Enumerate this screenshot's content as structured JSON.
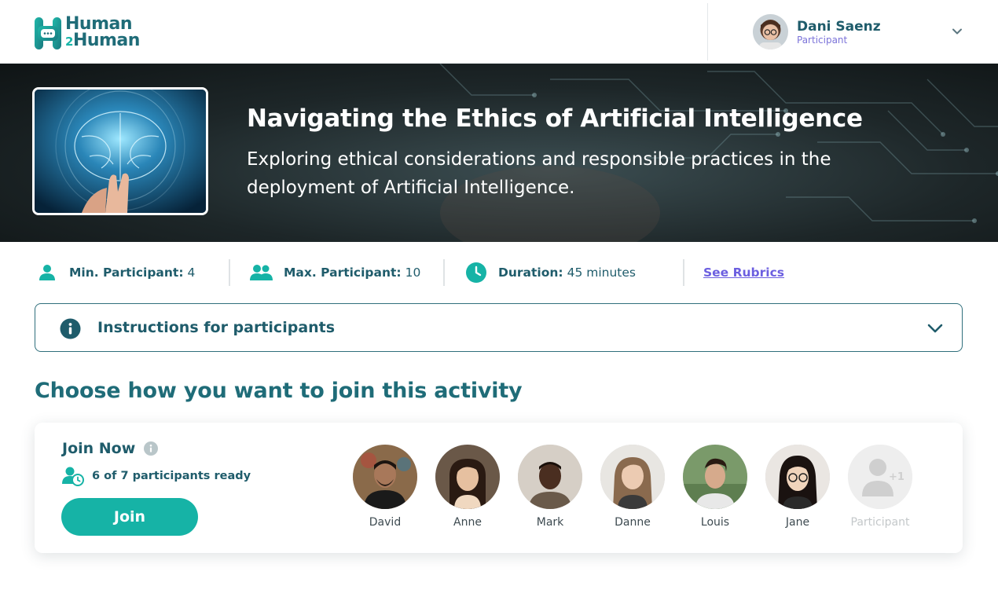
{
  "header": {
    "logo": {
      "line1": "Human",
      "num": "2",
      "line2": "Human"
    },
    "user": {
      "name": "Dani Saenz",
      "role": "Participant"
    }
  },
  "hero": {
    "title": "Navigating the Ethics of Artificial Intelligence",
    "subtitle": "Exploring ethical considerations and responsible practices in the deployment of Artificial Intelligence."
  },
  "stats": {
    "min_label": "Min. Participant:",
    "min_value": "4",
    "max_label": "Max. Participant:",
    "max_value": "10",
    "duration_label": "Duration:",
    "duration_value": "45 minutes",
    "rubrics_link": "See Rubrics"
  },
  "accordion": {
    "label": "Instructions for participants"
  },
  "section": {
    "heading": "Choose how you want to join this activity"
  },
  "join": {
    "title": "Join Now",
    "ready_text": "6 of 7 participants ready",
    "button": "Join",
    "participants": [
      {
        "name": "David"
      },
      {
        "name": "Anne"
      },
      {
        "name": "Mark"
      },
      {
        "name": "Danne"
      },
      {
        "name": "Louis"
      },
      {
        "name": "Jane"
      },
      {
        "name": "Participant",
        "badge": "+1",
        "placeholder": true
      }
    ]
  },
  "colors": {
    "primary_dark": "#1f5c6b",
    "accent_teal": "#16b3a6",
    "link_purple": "#6c5fe0",
    "role_purple": "#7b73d9"
  }
}
